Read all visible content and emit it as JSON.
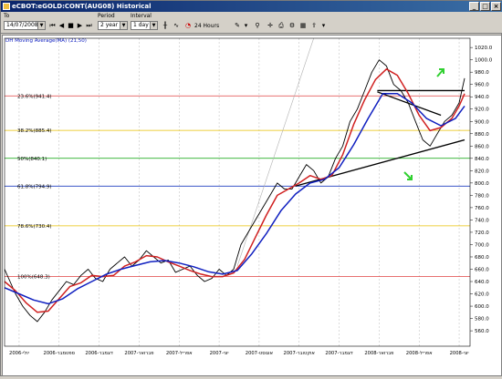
{
  "window": {
    "title": "eCBOT:eGOLD:CONT(AUG08) Historical"
  },
  "toolbar": {
    "to_label": "To",
    "to_value": "14/07/2008",
    "period_label": "Period",
    "period_value": "2 year",
    "interval_label": "Interval",
    "interval_value": "1 day",
    "hours_label": "24 Hours"
  },
  "chart_data": {
    "type": "line",
    "study_label": "DH Moving Average(MA) (21,50)",
    "ylim": [
      535,
      1035
    ],
    "y_ticks": [
      560,
      580,
      600,
      620,
      640,
      660,
      680,
      700,
      720,
      740,
      760,
      780,
      800,
      820,
      840,
      860,
      880,
      900,
      920,
      940,
      960,
      980,
      1000,
      1020
    ],
    "x_ticks": [
      "2006-יולי",
      "2006-ספטמבר",
      "2006-דצמבר",
      "2007-פברואר",
      "2007-אפריל",
      "2007-יוני",
      "2007-אוגוסט",
      "2007-אוקטובר",
      "2007-דצמבר",
      "2008-פברואר",
      "2008-אפריל",
      "2008-יוני"
    ],
    "fib_levels": [
      {
        "label": "23.6%(941.4)",
        "value": 941.4,
        "color": "#e04040"
      },
      {
        "label": "38.2%(885.4)",
        "value": 885.4,
        "color": "#e8c000"
      },
      {
        "label": "50%(840.1)",
        "value": 840.1,
        "color": "#00a000"
      },
      {
        "label": "61.8%(794.9)",
        "value": 794.9,
        "color": "#2040c0"
      },
      {
        "label": "78.6%(730.4)",
        "value": 730.4,
        "color": "#e8c000"
      },
      {
        "label": "100%(648.3)",
        "value": 648.3,
        "color": "#e04040"
      }
    ],
    "series": [
      {
        "name": "",
        "color": "#000000",
        "x": [
          0,
          3,
          6,
          10,
          14,
          18,
          22,
          26,
          30,
          34,
          38,
          42,
          46,
          50,
          54,
          58,
          62,
          66,
          70,
          74,
          78,
          82,
          86,
          90,
          94,
          98,
          102,
          106,
          110,
          114,
          118,
          122,
          126,
          130,
          134,
          138,
          142,
          146,
          150,
          154,
          158,
          162,
          166,
          170,
          174,
          178,
          182,
          186,
          190,
          194,
          198,
          202,
          206,
          210,
          214,
          218,
          222,
          226,
          230,
          234,
          238,
          242,
          246,
          250,
          253
        ],
        "values": [
          660,
          640,
          620,
          600,
          585,
          575,
          590,
          610,
          625,
          640,
          635,
          650,
          660,
          645,
          640,
          660,
          670,
          680,
          665,
          675,
          690,
          680,
          670,
          675,
          655,
          660,
          665,
          650,
          640,
          645,
          660,
          650,
          660,
          700,
          720,
          740,
          760,
          780,
          800,
          790,
          790,
          810,
          830,
          820,
          800,
          810,
          840,
          860,
          900,
          920,
          950,
          980,
          1000,
          990,
          960,
          950,
          930,
          900,
          870,
          860,
          880,
          900,
          910,
          930,
          970
        ]
      },
      {
        "name": "",
        "color": "#d02020",
        "x": [
          0,
          6,
          12,
          18,
          24,
          30,
          36,
          42,
          48,
          54,
          60,
          66,
          72,
          78,
          84,
          90,
          96,
          102,
          108,
          114,
          120,
          126,
          132,
          138,
          144,
          150,
          156,
          162,
          168,
          174,
          180,
          186,
          192,
          198,
          204,
          210,
          216,
          222,
          228,
          234,
          240,
          246,
          250,
          253
        ],
        "values": [
          640,
          625,
          605,
          590,
          592,
          612,
          632,
          638,
          650,
          648,
          650,
          665,
          672,
          682,
          680,
          672,
          665,
          658,
          652,
          648,
          648,
          654,
          676,
          712,
          748,
          780,
          790,
          800,
          812,
          806,
          812,
          846,
          895,
          935,
          968,
          985,
          975,
          945,
          910,
          885,
          890,
          905,
          925,
          945
        ]
      },
      {
        "name": "",
        "color": "#1020c0",
        "x": [
          0,
          8,
          16,
          24,
          32,
          40,
          48,
          56,
          64,
          72,
          80,
          88,
          96,
          104,
          112,
          120,
          128,
          136,
          144,
          152,
          160,
          168,
          176,
          184,
          192,
          200,
          208,
          216,
          224,
          232,
          240,
          248,
          253
        ],
        "values": [
          630,
          620,
          610,
          604,
          612,
          628,
          640,
          652,
          660,
          666,
          672,
          674,
          670,
          664,
          656,
          652,
          658,
          685,
          718,
          755,
          782,
          800,
          806,
          825,
          862,
          905,
          945,
          945,
          930,
          905,
          893,
          905,
          925
        ]
      }
    ],
    "trendlines": [
      {
        "name": "support",
        "color": "#000000",
        "from": [
          160,
          795
        ],
        "to": [
          253,
          870
        ]
      },
      {
        "name": "resistance",
        "color": "#000000",
        "from": [
          205,
          950
        ],
        "to": [
          253,
          950
        ]
      },
      {
        "name": "channel",
        "color": "#000000",
        "from": [
          205,
          948
        ],
        "to": [
          240,
          910
        ]
      },
      {
        "name": "fan",
        "color": "#b0b0b0",
        "from": [
          128,
          665
        ],
        "to": [
          170,
          1035
        ]
      }
    ]
  }
}
